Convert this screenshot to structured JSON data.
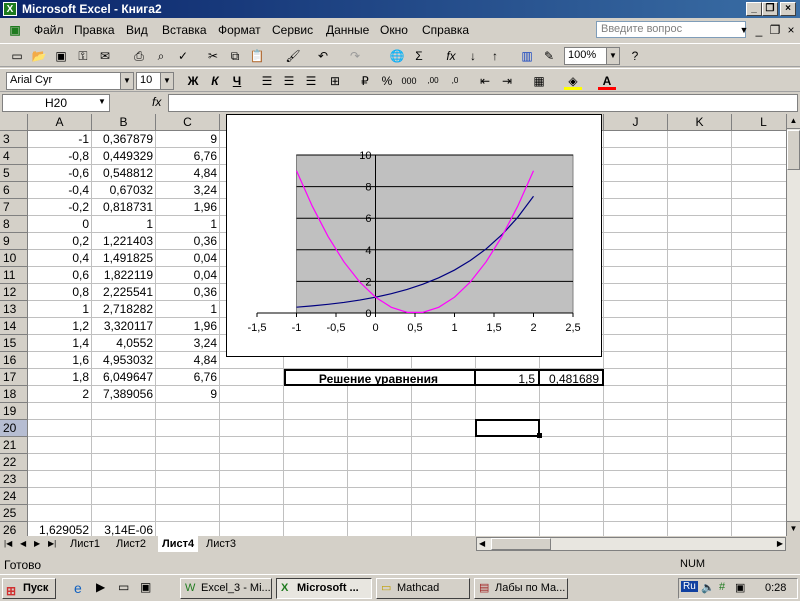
{
  "window": {
    "title": "Microsoft Excel - Книга2",
    "icon_label": "X"
  },
  "menu": {
    "items": [
      "Файл",
      "Правка",
      "Вид",
      "Вставка",
      "Формат",
      "Сервис",
      "Данные",
      "Окно",
      "Справка"
    ],
    "ask_placeholder": "Введите вопрос"
  },
  "toolbar": {
    "zoom": "100%",
    "font_name": "Arial Cyr",
    "font_size": "10",
    "bold": "Ж",
    "italic": "К",
    "underline": "Ч"
  },
  "formula_bar": {
    "name_box": "H20",
    "fx": "fx",
    "formula": ""
  },
  "sheet": {
    "columns": [
      "A",
      "B",
      "C",
      "D",
      "E",
      "F",
      "G",
      "H",
      "I",
      "J",
      "K",
      "L"
    ],
    "rows": [
      "3",
      "4",
      "5",
      "6",
      "7",
      "8",
      "9",
      "10",
      "11",
      "12",
      "13",
      "14",
      "15",
      "16",
      "17",
      "18",
      "19",
      "20",
      "21",
      "22",
      "23",
      "24",
      "25",
      "26"
    ],
    "data": [
      [
        "-1",
        "0,367879",
        "9"
      ],
      [
        "-0,8",
        "0,449329",
        "6,76"
      ],
      [
        "-0,6",
        "0,548812",
        "4,84"
      ],
      [
        "-0,4",
        "0,67032",
        "3,24"
      ],
      [
        "-0,2",
        "0,818731",
        "1,96"
      ],
      [
        "0",
        "1",
        "1"
      ],
      [
        "0,2",
        "1,221403",
        "0,36"
      ],
      [
        "0,4",
        "1,491825",
        "0,04"
      ],
      [
        "0,6",
        "1,822119",
        "0,04"
      ],
      [
        "0,8",
        "2,225541",
        "0,36"
      ],
      [
        "1",
        "2,718282",
        "1"
      ],
      [
        "1,2",
        "3,320117",
        "1,96"
      ],
      [
        "1,4",
        "4,0552",
        "3,24"
      ],
      [
        "1,6",
        "4,953032",
        "4,84"
      ],
      [
        "1,8",
        "6,049647",
        "6,76"
      ],
      [
        "2",
        "7,389056",
        "9"
      ]
    ],
    "row26": [
      "1,629052",
      "3,14E-06"
    ],
    "solution": {
      "label": "Решение уравнения",
      "h_value": "1,5",
      "i_value": "0,481689"
    }
  },
  "chart_data": {
    "type": "line",
    "x": [
      -1,
      -0.8,
      -0.6,
      -0.4,
      -0.2,
      0,
      0.2,
      0.4,
      0.6,
      0.8,
      1,
      1.2,
      1.4,
      1.6,
      1.8,
      2
    ],
    "series": [
      {
        "values": [
          0.367879,
          0.449329,
          0.548812,
          0.67032,
          0.818731,
          1,
          1.221403,
          1.491825,
          1.822119,
          2.225541,
          2.718282,
          3.320117,
          4.0552,
          4.953032,
          6.049647,
          7.389056
        ],
        "color": "#000080"
      },
      {
        "values": [
          9,
          6.76,
          4.84,
          3.24,
          1.96,
          1,
          0.36,
          0.04,
          0.04,
          0.36,
          1,
          1.96,
          3.24,
          4.84,
          6.76,
          9
        ],
        "color": "#ff00ff"
      }
    ],
    "xlim": [
      -1.5,
      2.5
    ],
    "ylim": [
      0,
      10
    ],
    "x_ticks": [
      "-1,5",
      "-1",
      "-0,5",
      "0",
      "0,5",
      "1",
      "1,5",
      "2",
      "2,5"
    ],
    "y_ticks": [
      "0",
      "2",
      "4",
      "6",
      "8",
      "10"
    ],
    "grid": true,
    "plot_bg": "#c0c0c0"
  },
  "tabs": {
    "items": [
      "Лист1",
      "Лист2",
      "Лист4",
      "Лист3"
    ],
    "active": "Лист4"
  },
  "status": {
    "left": "Готово",
    "num": "NUM"
  },
  "taskbar": {
    "start": "Пуск",
    "tasks": [
      "Excel_3 - Mi...",
      "Microsoft ...",
      "Mathcad",
      "Лабы по Ма..."
    ],
    "lang": "Ru",
    "clock": "0:28"
  }
}
